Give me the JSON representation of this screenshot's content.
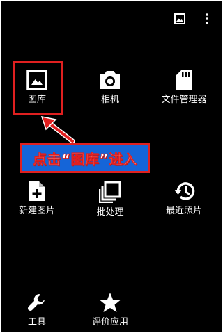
{
  "colors": {
    "background": "#000000",
    "highlight": "#e02020",
    "callout_background": "#1565d8",
    "text": "#ffffff"
  },
  "topbar": {
    "gallery_icon": "image-icon",
    "menu_icon": "more-vertical-icon"
  },
  "tiles": [
    {
      "label": "图库",
      "icon": "image-icon"
    },
    {
      "label": "相机",
      "icon": "camera-icon"
    },
    {
      "label": "文件管理器",
      "icon": "sd-card-icon"
    },
    {
      "label": "新建图片",
      "icon": "new-file-icon"
    },
    {
      "label": "批处理",
      "icon": "stacked-squares-icon"
    },
    {
      "label": "最近照片",
      "icon": "history-icon"
    },
    {
      "label": "工具",
      "icon": "wrench-icon"
    },
    {
      "label": "评价应用",
      "icon": "star-icon"
    }
  ],
  "annotation": {
    "callout_text": "点击“图库”进入",
    "arrow_icon": "red-arrow-icon"
  }
}
